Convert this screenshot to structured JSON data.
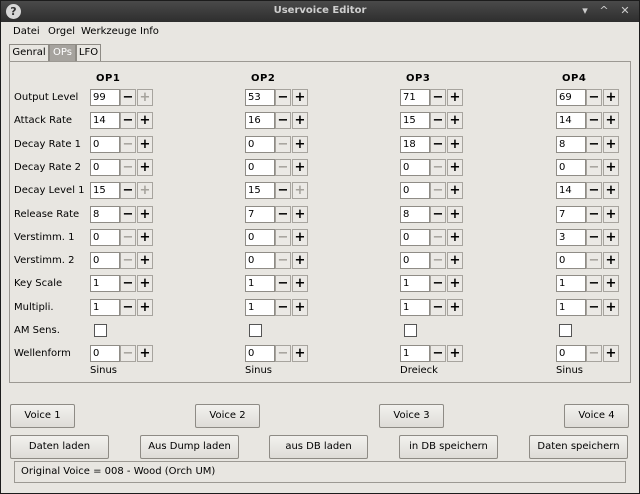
{
  "window": {
    "title": "Uservoice Editor",
    "icon": "?"
  },
  "menu": [
    "Datei",
    "Orgel",
    "Werkzeuge",
    "Info"
  ],
  "tabs": [
    {
      "label": "Genral",
      "active": false
    },
    {
      "label": "OPs",
      "active": true
    },
    {
      "label": "LFO",
      "active": false
    }
  ],
  "operators": [
    "OP1",
    "OP2",
    "OP3",
    "OP4"
  ],
  "params": [
    {
      "label": "Output Level",
      "values": [
        "99",
        "53",
        "71",
        "69"
      ]
    },
    {
      "label": "Attack Rate",
      "values": [
        "14",
        "16",
        "15",
        "14"
      ]
    },
    {
      "label": "Decay Rate 1",
      "values": [
        "0",
        "0",
        "18",
        "8"
      ]
    },
    {
      "label": "Decay Rate 2",
      "values": [
        "0",
        "0",
        "0",
        "0"
      ]
    },
    {
      "label": "Decay Level 1",
      "values": [
        "15",
        "15",
        "0",
        "14"
      ]
    },
    {
      "label": "Release Rate",
      "values": [
        "8",
        "7",
        "8",
        "7"
      ]
    },
    {
      "label": "Verstimm. 1",
      "values": [
        "0",
        "0",
        "0",
        "3"
      ]
    },
    {
      "label": "Verstimm. 2",
      "values": [
        "0",
        "0",
        "0",
        "0"
      ]
    },
    {
      "label": "Key Scale",
      "values": [
        "1",
        "1",
        "1",
        "1"
      ]
    },
    {
      "label": "Multipli.",
      "values": [
        "1",
        "1",
        "1",
        "1"
      ]
    }
  ],
  "am_sens": {
    "label": "AM Sens."
  },
  "wellenform": {
    "label": "Wellenform",
    "values": [
      "0",
      "0",
      "1",
      "0"
    ],
    "names": [
      "Sinus",
      "Sinus",
      "Dreieck",
      "Sinus"
    ]
  },
  "voice_buttons": [
    "Voice 1",
    "Voice 2",
    "Voice 3",
    "Voice 4"
  ],
  "action_buttons": [
    "Daten laden",
    "Aus Dump laden",
    "aus DB laden",
    "in DB speichern",
    "Daten speichern"
  ],
  "status": "Original Voice = 008 - Wood (Orch UM)"
}
